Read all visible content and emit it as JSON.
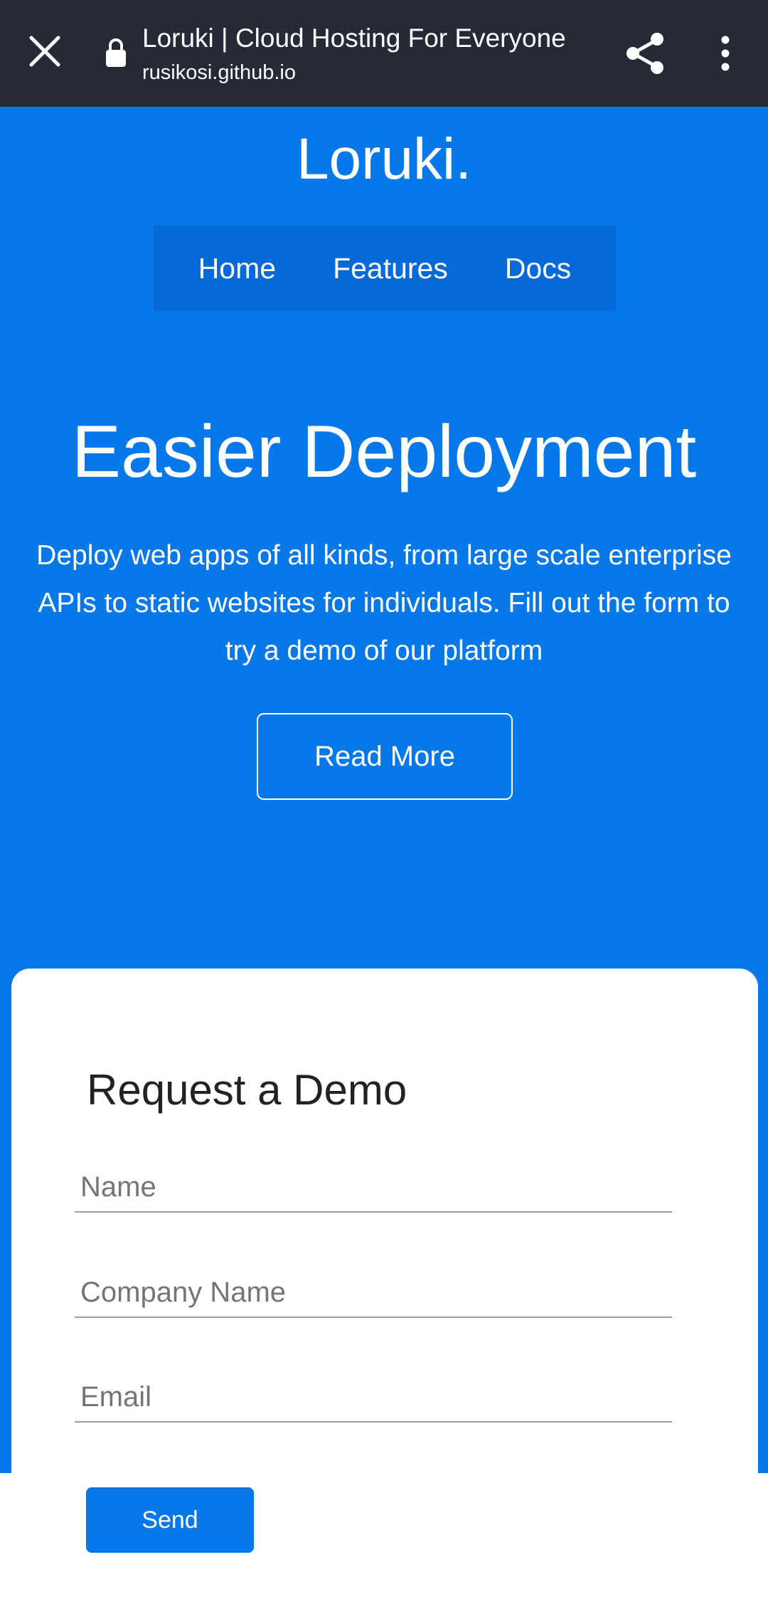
{
  "browser": {
    "title": "Loruki | Cloud Hosting For Everyone",
    "url": "rusikosi.github.io",
    "icons": [
      "close-icon",
      "lock-icon",
      "share-icon",
      "more-vert-icon"
    ]
  },
  "header": {
    "brand": "Loruki.",
    "nav": [
      {
        "label": "Home"
      },
      {
        "label": "Features"
      },
      {
        "label": "Docs"
      }
    ]
  },
  "hero": {
    "title": "Easier Deployment",
    "text": "Deploy web apps of all kinds, from large scale enterprise APIs to static websites for individuals. Fill out the form to try a demo of our platform",
    "cta": "Read More"
  },
  "form": {
    "title": "Request a Demo",
    "name_placeholder": "Name",
    "company_placeholder": "Company Name",
    "email_placeholder": "Email",
    "submit": "Send"
  },
  "colors": {
    "topbar": "#252a36",
    "primary": "#0778ea",
    "nav_bg": "#056ad7"
  }
}
